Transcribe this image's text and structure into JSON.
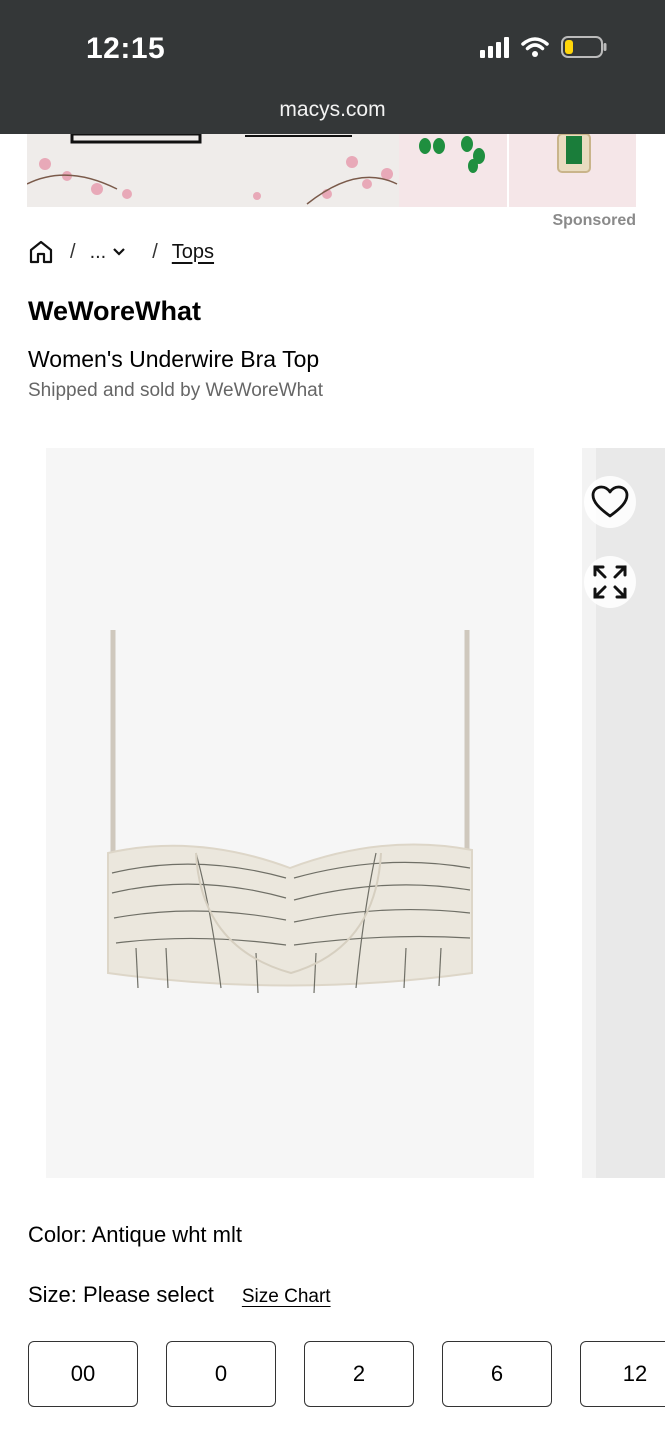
{
  "status_bar": {
    "time": "12:15",
    "url": "macys.com"
  },
  "ad": {
    "sponsored_label": "Sponsored"
  },
  "breadcrumb": {
    "separator": "/",
    "more": "...",
    "current": "Tops"
  },
  "product": {
    "brand": "WeWoreWhat",
    "title": "Women's Underwire Bra Top",
    "seller": "Shipped and sold by WeWoreWhat",
    "color_label": "Color: Antique wht mlt",
    "size_label": "Size: Please select",
    "size_chart_label": "Size Chart",
    "sizes": [
      "00",
      "0",
      "2",
      "6",
      "12"
    ]
  },
  "icons": [
    "home-icon",
    "chevron-down-icon",
    "heart-icon",
    "expand-icon",
    "wifi-icon",
    "battery-icon",
    "signal-icon"
  ],
  "colors": {
    "status_bg": "#343738",
    "battery_fill": "#ffd60a",
    "gem_green": "#1f8f3f"
  }
}
